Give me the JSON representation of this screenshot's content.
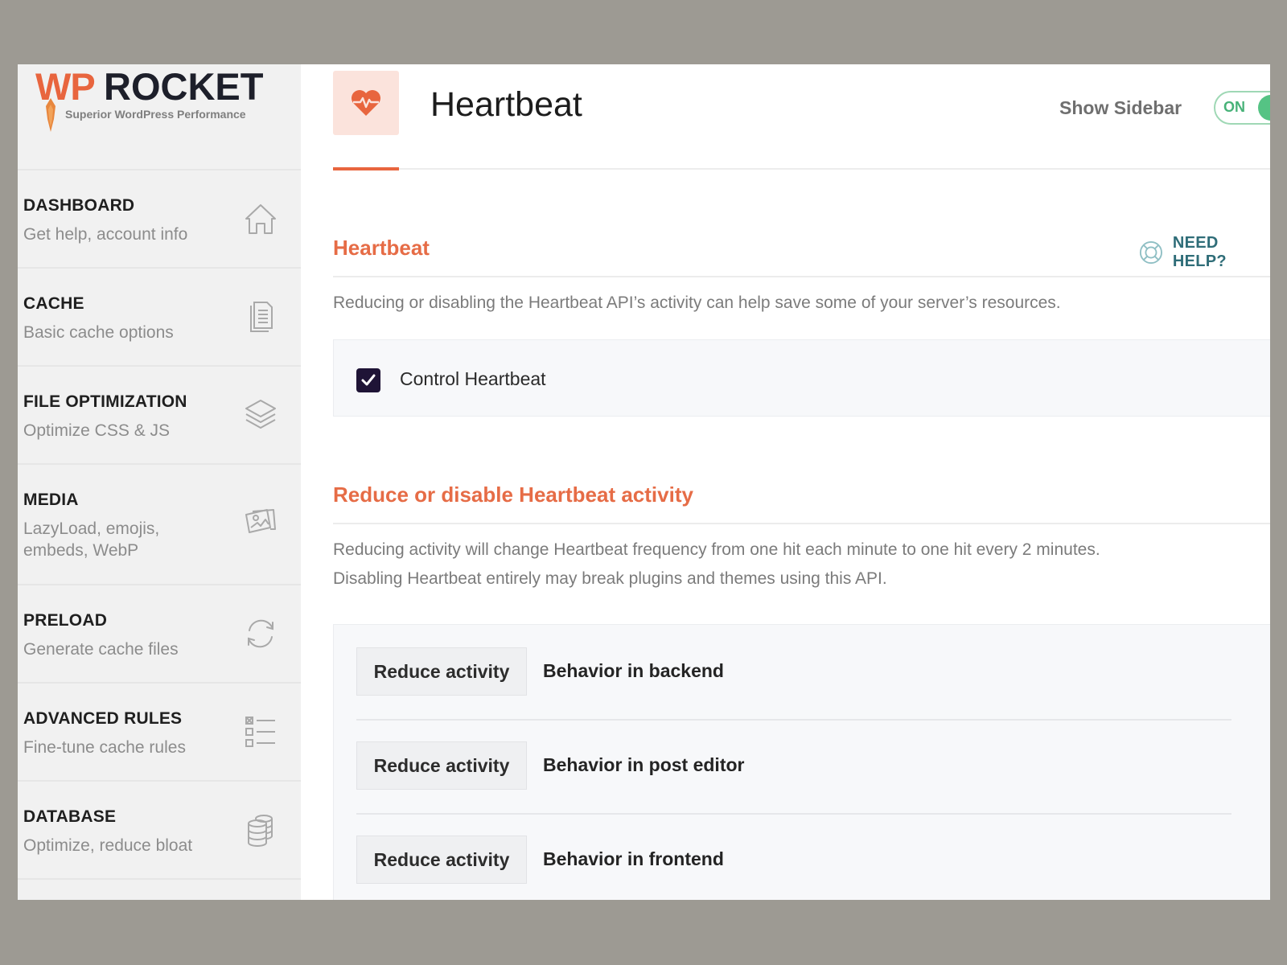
{
  "logo": {
    "wp": "WP",
    "rocket": "ROCKET",
    "tagline": "Superior WordPress Performance"
  },
  "sidebar": {
    "items": [
      {
        "title": "DASHBOARD",
        "subtitle": "Get help, account info",
        "icon": "home-icon"
      },
      {
        "title": "CACHE",
        "subtitle": "Basic cache options",
        "icon": "document-icon"
      },
      {
        "title": "FILE OPTIMIZATION",
        "subtitle": "Optimize CSS & JS",
        "icon": "layers-icon"
      },
      {
        "title": "MEDIA",
        "subtitle": "LazyLoad, emojis, embeds, WebP",
        "icon": "images-icon"
      },
      {
        "title": "PRELOAD",
        "subtitle": "Generate cache files",
        "icon": "refresh-icon"
      },
      {
        "title": "ADVANCED RULES",
        "subtitle": "Fine-tune cache rules",
        "icon": "checklist-icon"
      },
      {
        "title": "DATABASE",
        "subtitle": "Optimize, reduce bloat",
        "icon": "database-icon"
      }
    ]
  },
  "header": {
    "title": "Heartbeat",
    "icon": "heart-pulse-icon",
    "show_sidebar_label": "Show Sidebar",
    "toggle_label": "ON",
    "toggle_state": true
  },
  "colors": {
    "accent": "#e8653e",
    "toggle_green": "#55c384",
    "help_teal": "#2f6d78",
    "checkbox": "#1f1436"
  },
  "section1": {
    "title": "Heartbeat",
    "help_label": "NEED HELP?",
    "description": "Reducing or disabling the Heartbeat API’s activity can help save some of your server’s resources.",
    "checkbox_label": "Control Heartbeat",
    "checkbox_checked": true
  },
  "section2": {
    "title": "Reduce or disable Heartbeat activity",
    "description_line1": "Reducing activity will change Heartbeat frequency from one hit each minute to one hit every 2 minutes.",
    "description_line2": "Disabling Heartbeat entirely may break plugins and themes using this API.",
    "rows": [
      {
        "value": "Reduce activity",
        "label": "Behavior in backend"
      },
      {
        "value": "Reduce activity",
        "label": "Behavior in post editor"
      },
      {
        "value": "Reduce activity",
        "label": "Behavior in frontend"
      }
    ]
  }
}
